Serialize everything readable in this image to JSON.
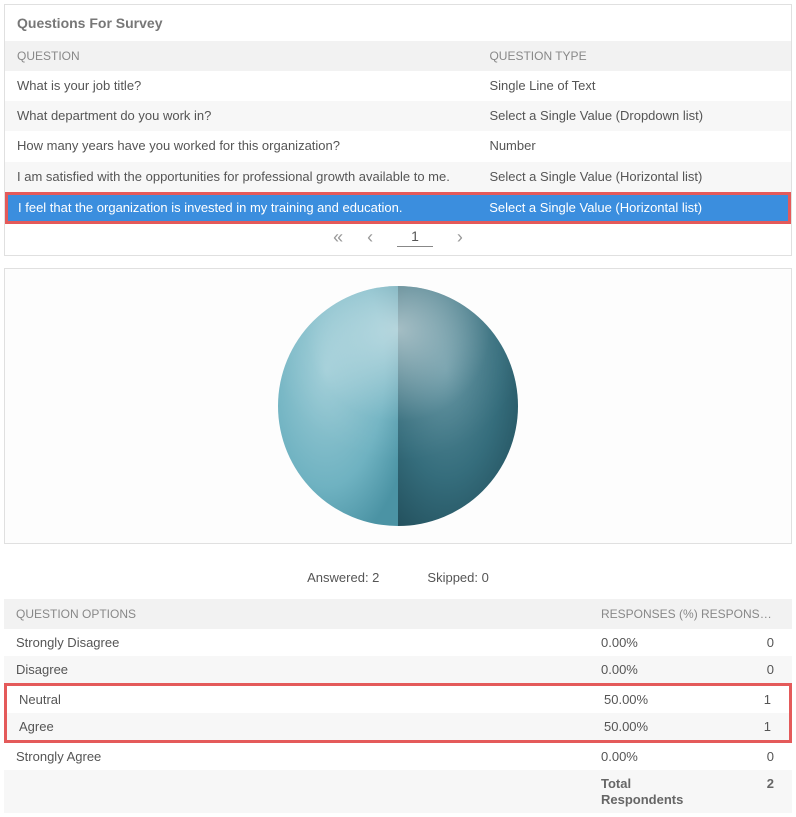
{
  "panel_title": "Questions For Survey",
  "columns": {
    "question": "QUESTION",
    "type": "QUESTION TYPE"
  },
  "rows": [
    {
      "q": "What is your job title?",
      "t": "Single Line of Text",
      "selected": false
    },
    {
      "q": "What department do you work in?",
      "t": "Select a Single Value (Dropdown list)",
      "selected": false
    },
    {
      "q": "How many years have you worked for this organization?",
      "t": "Number",
      "selected": false
    },
    {
      "q": "I am satisfied with the opportunities for professional growth available to me.",
      "t": "Select a Single Value (Horizontal list)",
      "selected": false
    },
    {
      "q": "I feel that the organization is invested in my training and education.",
      "t": "Select a Single Value (Horizontal list)",
      "selected": true
    }
  ],
  "paginator": {
    "page": "1"
  },
  "summary": {
    "answered_label": "Answered: 2",
    "skipped_label": "Skipped: 0"
  },
  "options_columns": {
    "option": "QUESTION OPTIONS",
    "pct": "RESPONSES (%)",
    "cnt": "RESPONSES (C..."
  },
  "options": [
    {
      "label": "Strongly Disagree",
      "pct": "0.00%",
      "cnt": "0",
      "hl": false
    },
    {
      "label": "Disagree",
      "pct": "0.00%",
      "cnt": "0",
      "hl": false
    },
    {
      "label": "Neutral",
      "pct": "50.00%",
      "cnt": "1",
      "hl": true
    },
    {
      "label": "Agree",
      "pct": "50.00%",
      "cnt": "1",
      "hl": true
    },
    {
      "label": "Strongly Agree",
      "pct": "0.00%",
      "cnt": "0",
      "hl": false
    }
  ],
  "total": {
    "label": "Total Respondents",
    "value": "2"
  },
  "chart_data": {
    "type": "pie",
    "title": "",
    "series": [
      {
        "name": "Neutral",
        "value": 50,
        "color": "#6fb2c1"
      },
      {
        "name": "Agree",
        "value": 50,
        "color": "#356d7c"
      }
    ]
  }
}
